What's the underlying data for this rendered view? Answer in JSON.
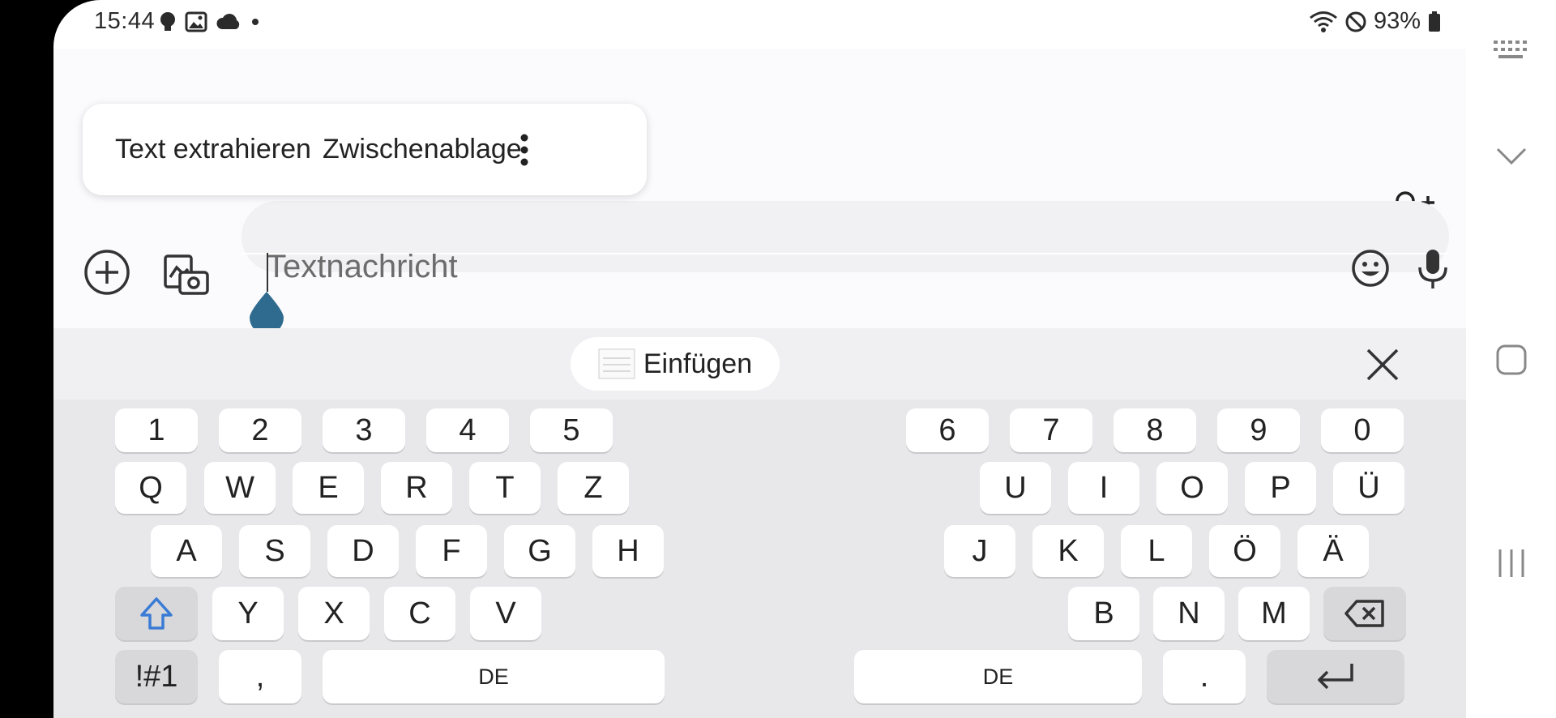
{
  "status_bar": {
    "time": "15:44",
    "battery": "93%"
  },
  "popup_menu": {
    "items": [
      "Text extrahieren",
      "Zwischenablage"
    ]
  },
  "compose": {
    "placeholder": "Textnachricht"
  },
  "keyboard_toolbar": {
    "paste_label": "Einfügen"
  },
  "keyboard": {
    "number_row_left": [
      "1",
      "2",
      "3",
      "4",
      "5"
    ],
    "number_row_right": [
      "6",
      "7",
      "8",
      "9",
      "0"
    ],
    "row1_left": [
      "Q",
      "W",
      "E",
      "R",
      "T",
      "Z"
    ],
    "row1_right": [
      "U",
      "I",
      "O",
      "P",
      "Ü"
    ],
    "row2_left": [
      "A",
      "S",
      "D",
      "F",
      "G",
      "H"
    ],
    "row2_right": [
      "J",
      "K",
      "L",
      "Ö",
      "Ä"
    ],
    "row3_left": [
      "Y",
      "X",
      "C",
      "V"
    ],
    "row3_right": [
      "B",
      "N",
      "M"
    ],
    "symbols_label": "!#1",
    "comma_label": ",",
    "space_left_label": "DE",
    "space_right_label": "DE",
    "period_label": "."
  }
}
